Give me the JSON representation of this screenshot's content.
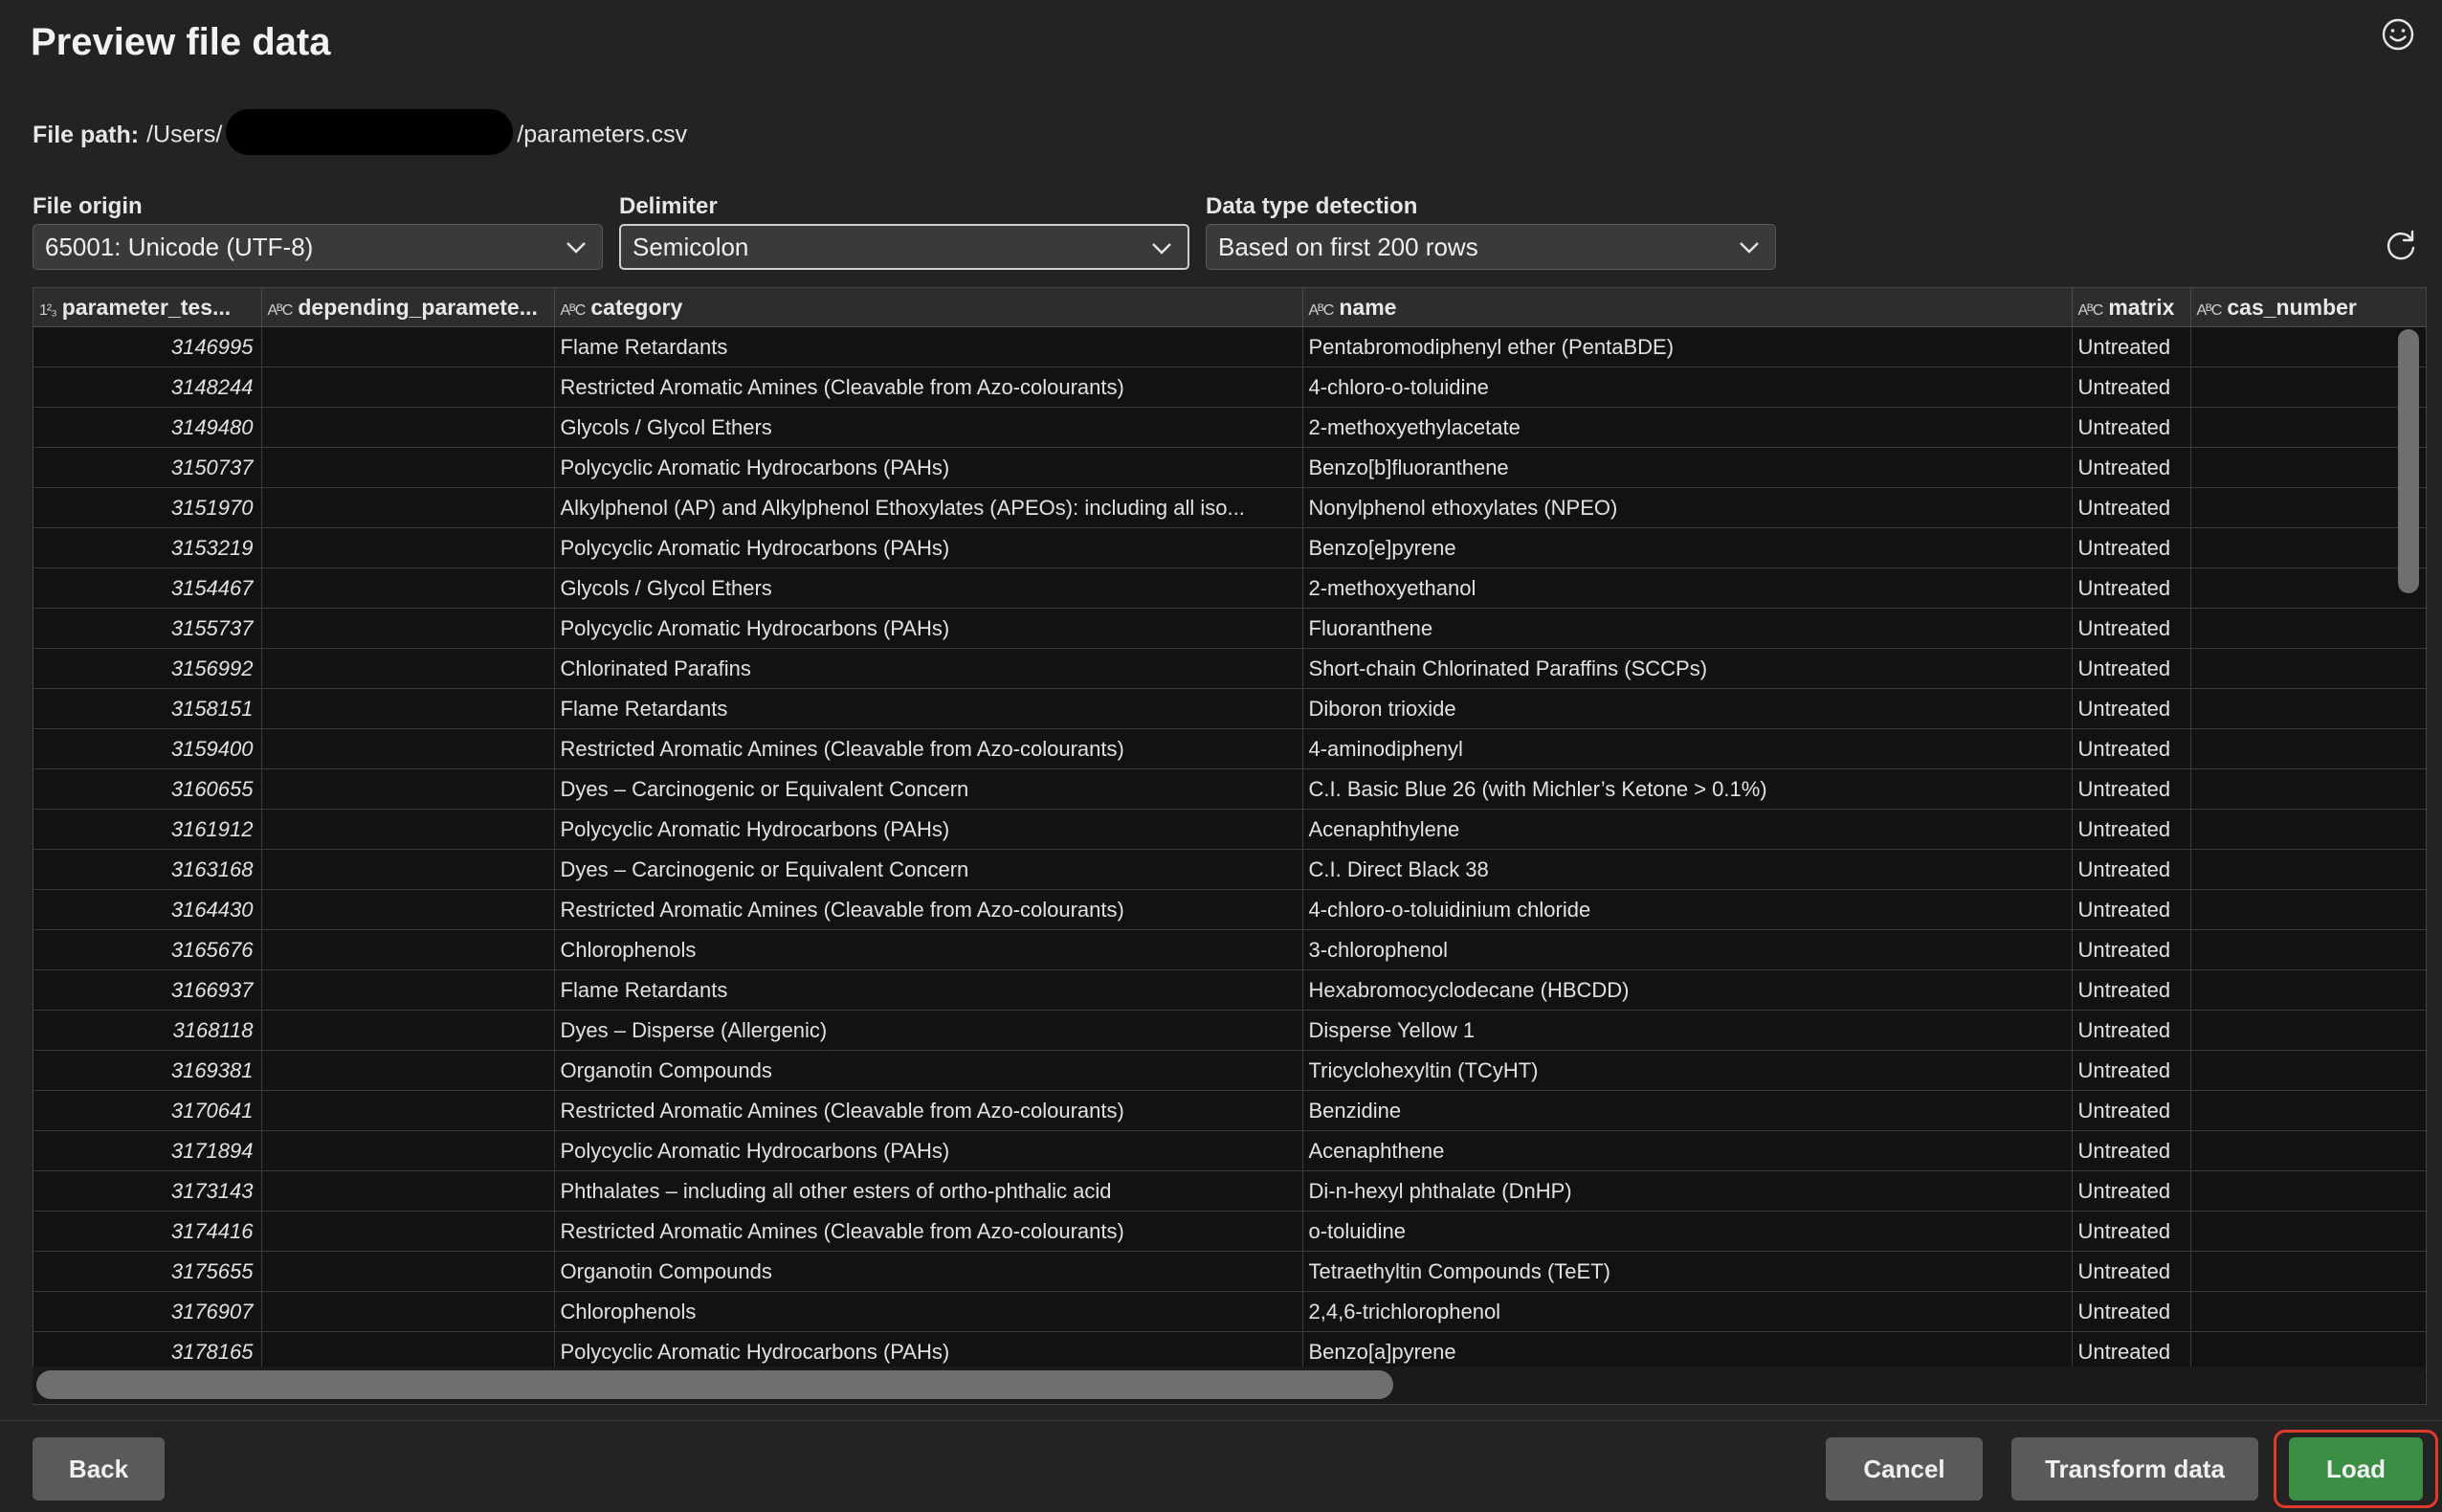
{
  "dialog": {
    "title": "Preview file data",
    "feedback_icon": "smiley-icon"
  },
  "file_path": {
    "label": "File path:",
    "prefix": "/Users/",
    "suffix": "/parameters.csv"
  },
  "options": {
    "file_origin": {
      "label": "File origin",
      "value": "65001: Unicode (UTF-8)"
    },
    "delimiter": {
      "label": "Delimiter",
      "value": "Semicolon"
    },
    "data_type_detection": {
      "label": "Data type detection",
      "value": "Based on first 200 rows"
    }
  },
  "grid": {
    "columns": [
      {
        "type_icon": "1²₃",
        "label": "parameter_tes..."
      },
      {
        "type_icon": "AᴮC",
        "label": "depending_paramete..."
      },
      {
        "type_icon": "AᴮC",
        "label": "category"
      },
      {
        "type_icon": "AᴮC",
        "label": "name"
      },
      {
        "type_icon": "AᴮC",
        "label": "matrix"
      },
      {
        "type_icon": "AᴮC",
        "label": "cas_number"
      }
    ],
    "rows": [
      [
        "3146995",
        "",
        "Flame Retardants",
        "Pentabromodiphenyl ether (PentaBDE)",
        "Untreated",
        ""
      ],
      [
        "3148244",
        "",
        "Restricted Aromatic Amines (Cleavable from Azo-colourants)",
        "4-chloro-o-toluidine",
        "Untreated",
        ""
      ],
      [
        "3149480",
        "",
        "Glycols / Glycol Ethers",
        "2-methoxyethylacetate",
        "Untreated",
        ""
      ],
      [
        "3150737",
        "",
        "Polycyclic Aromatic Hydrocarbons (PAHs)",
        "Benzo[b]fluoranthene",
        "Untreated",
        ""
      ],
      [
        "3151970",
        "",
        "Alkylphenol (AP) and Alkylphenol Ethoxylates (APEOs): including all iso...",
        "Nonylphenol ethoxylates (NPEO)",
        "Untreated",
        ""
      ],
      [
        "3153219",
        "",
        "Polycyclic Aromatic Hydrocarbons (PAHs)",
        "Benzo[e]pyrene",
        "Untreated",
        ""
      ],
      [
        "3154467",
        "",
        "Glycols / Glycol Ethers",
        "2-methoxyethanol",
        "Untreated",
        ""
      ],
      [
        "3155737",
        "",
        "Polycyclic Aromatic Hydrocarbons (PAHs)",
        "Fluoranthene",
        "Untreated",
        ""
      ],
      [
        "3156992",
        "",
        "Chlorinated Parafins",
        "Short-chain Chlorinated Paraffins (SCCPs)",
        "Untreated",
        ""
      ],
      [
        "3158151",
        "",
        "Flame Retardants",
        "Diboron trioxide",
        "Untreated",
        ""
      ],
      [
        "3159400",
        "",
        "Restricted Aromatic Amines (Cleavable from Azo-colourants)",
        "4-aminodiphenyl",
        "Untreated",
        ""
      ],
      [
        "3160655",
        "",
        "Dyes – Carcinogenic or Equivalent Concern",
        "C.I. Basic Blue 26 (with Michler’s Ketone > 0.1%)",
        "Untreated",
        ""
      ],
      [
        "3161912",
        "",
        "Polycyclic Aromatic Hydrocarbons (PAHs)",
        "Acenaphthylene",
        "Untreated",
        ""
      ],
      [
        "3163168",
        "",
        "Dyes – Carcinogenic or Equivalent Concern",
        "C.I. Direct Black 38",
        "Untreated",
        ""
      ],
      [
        "3164430",
        "",
        "Restricted Aromatic Amines (Cleavable from Azo-colourants)",
        "4-chloro-o-toluidinium chloride",
        "Untreated",
        ""
      ],
      [
        "3165676",
        "",
        "Chlorophenols",
        "3-chlorophenol",
        "Untreated",
        ""
      ],
      [
        "3166937",
        "",
        "Flame Retardants",
        "Hexabromocyclodecane (HBCDD)",
        "Untreated",
        ""
      ],
      [
        "3168118",
        "",
        "Dyes – Disperse (Allergenic)",
        "Disperse Yellow 1",
        "Untreated",
        ""
      ],
      [
        "3169381",
        "",
        "Organotin Compounds",
        "Tricyclohexyltin (TCyHT)",
        "Untreated",
        ""
      ],
      [
        "3170641",
        "",
        "Restricted Aromatic Amines (Cleavable from Azo-colourants)",
        "Benzidine",
        "Untreated",
        ""
      ],
      [
        "3171894",
        "",
        "Polycyclic Aromatic Hydrocarbons (PAHs)",
        "Acenaphthene",
        "Untreated",
        ""
      ],
      [
        "3173143",
        "",
        "Phthalates – including all other esters of ortho-phthalic acid",
        "Di-n-hexyl phthalate (DnHP)",
        "Untreated",
        ""
      ],
      [
        "3174416",
        "",
        "Restricted Aromatic Amines (Cleavable from Azo-colourants)",
        "o-toluidine",
        "Untreated",
        ""
      ],
      [
        "3175655",
        "",
        "Organotin Compounds",
        "Tetraethyltin Compounds (TeET)",
        "Untreated",
        ""
      ],
      [
        "3176907",
        "",
        "Chlorophenols",
        "2,4,6-trichlorophenol",
        "Untreated",
        ""
      ],
      [
        "3178165",
        "",
        "Polycyclic Aromatic Hydrocarbons (PAHs)",
        "Benzo[a]pyrene",
        "Untreated",
        ""
      ]
    ]
  },
  "buttons": {
    "back": "Back",
    "cancel": "Cancel",
    "transform": "Transform data",
    "load": "Load"
  },
  "colors": {
    "primary_button": "#3a8f45",
    "highlight_ring": "#e03a2a",
    "background": "#232323"
  }
}
